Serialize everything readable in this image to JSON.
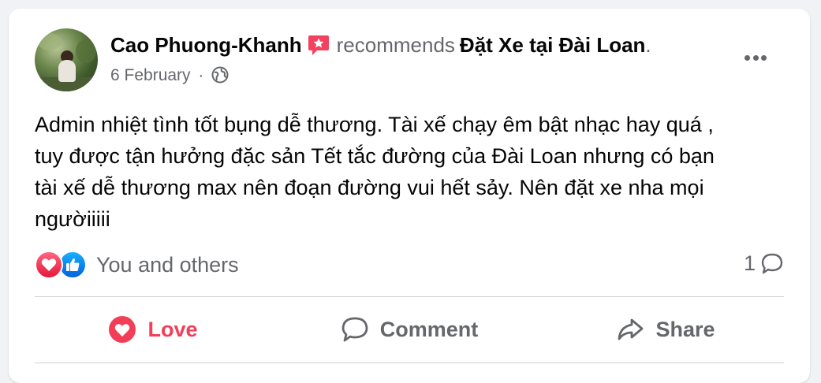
{
  "post": {
    "author": "Cao Phuong-Khanh",
    "recommends_text": "recommends",
    "page_name": "Đặt Xe tại Đài Loan",
    "page_suffix": ".",
    "date": "6 February",
    "meta_separator": "·",
    "privacy_icon": "globe-icon",
    "body": "Admin nhiệt tình tốt bụng dễ thương. Tài xế chạy êm bật nhạc hay quá ,\ntuy được tận hưởng đặc sản Tết tắc đường của Đài Loan nhưng có bạn\ntài xế dễ thương max nên đoạn đường vui hết sảy. Nên đặt xe nha mọi\nngườiiiii"
  },
  "reactions": {
    "icons": [
      "love-icon",
      "like-icon"
    ],
    "summary": "You and others",
    "comment_count": "1"
  },
  "actions": {
    "love_label": "Love",
    "comment_label": "Comment",
    "share_label": "Share"
  },
  "colors": {
    "love": "#f33e58",
    "like": "#0866ff",
    "recommend_badge": "#f3425f",
    "secondary_text": "#65676b"
  }
}
